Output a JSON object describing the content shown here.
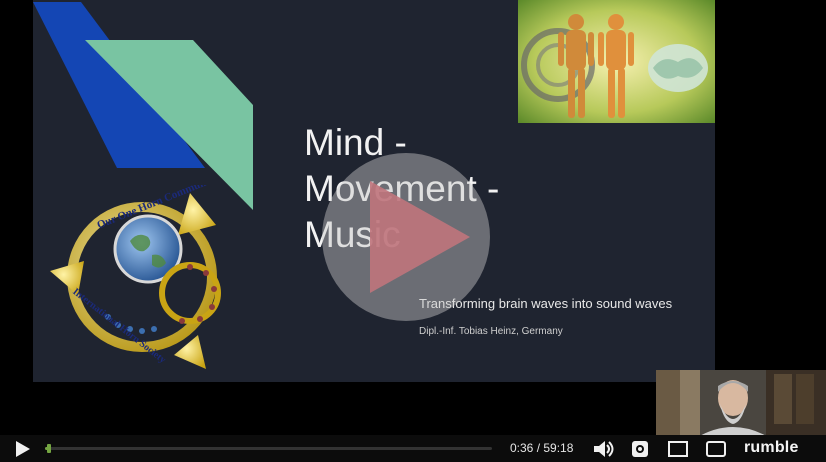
{
  "slide": {
    "title": "Mind -\nMovement -\nMusic",
    "subtitle": "Transforming brain waves into sound waves",
    "author": "Dipl.-Inf. Tobias Heinz, Germany",
    "logo_text_top": "Our One Horn Community",
    "logo_text_bottom": "International Horn Society"
  },
  "player": {
    "time_current": "0:36",
    "time_separator": " / ",
    "time_total": "59:18",
    "progress": 0.01,
    "brand": "rumble"
  },
  "colors": {
    "slide_bg": "#1f2430",
    "shape_blue": "#1446b4",
    "shape_green": "#79c4a2",
    "progress": "#75a642",
    "play_overlay": "rgba(200,200,200,0.45)"
  },
  "icons": {
    "play": "play-icon",
    "volume": "volume-icon",
    "settings": "gear-icon",
    "theater": "theater-mode-icon",
    "pip": "picture-in-picture-icon"
  }
}
